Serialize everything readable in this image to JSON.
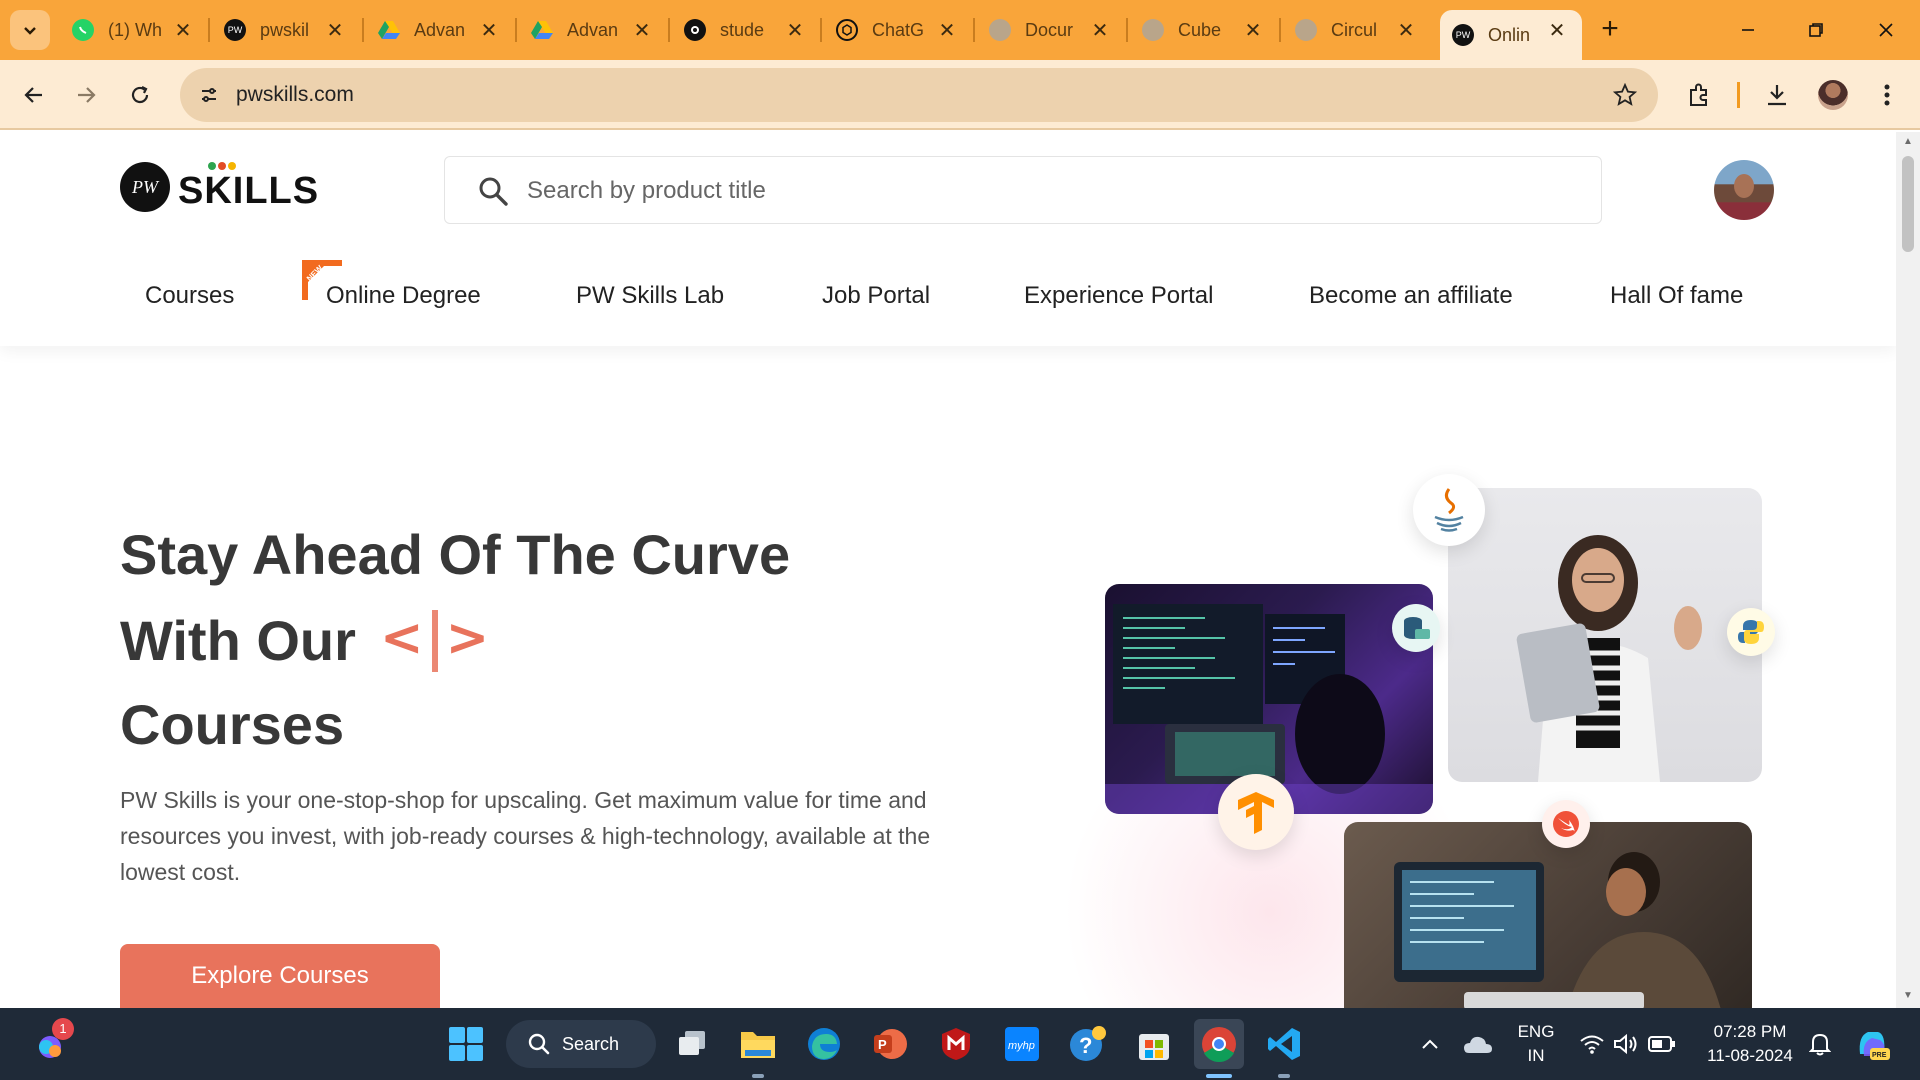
{
  "browser": {
    "tabs": [
      {
        "label": "(1) Wh",
        "icon": "whatsapp-icon"
      },
      {
        "label": "pwskil",
        "icon": "pwskills-favicon-icon"
      },
      {
        "label": "Advan",
        "icon": "google-drive-icon"
      },
      {
        "label": "Advan",
        "icon": "google-drive-icon"
      },
      {
        "label": "stude",
        "icon": "github-icon"
      },
      {
        "label": "ChatG",
        "icon": "chatgpt-icon"
      },
      {
        "label": "Docur",
        "icon": "globe-icon"
      },
      {
        "label": "Cube",
        "icon": "globe-icon"
      },
      {
        "label": "Circul",
        "icon": "globe-icon"
      },
      {
        "label": "Onlin",
        "icon": "pwskills-favicon-icon",
        "active": true
      }
    ],
    "new_tab": "+",
    "url": "pwskills.com"
  },
  "site": {
    "logo_badge": "PW",
    "logo_text": "SKILLS",
    "search_placeholder": "Search by product title",
    "nav": [
      "Courses",
      "Online Degree",
      "PW Skills Lab",
      "Job Portal",
      "Experience Portal",
      "Become an affiliate",
      "Hall Of fame"
    ],
    "new_badge": "NEW",
    "hero": {
      "line1": "Stay Ahead Of The Curve",
      "line2": "With Our",
      "code_symbol_left": "<",
      "code_symbol_right": ">",
      "line3": "Courses",
      "description": "PW Skills is your one-stop-shop for upscaling. Get maximum value for time and resources you invest, with job-ready courses & high-technology, available at the lowest cost.",
      "cta": "Explore Courses"
    },
    "tech_bubbles": [
      "java-icon",
      "sql-icon",
      "python-icon",
      "tensorflow-icon",
      "swift-icon"
    ]
  },
  "taskbar": {
    "search_label": "Search",
    "notification_count": "1",
    "language": "ENG",
    "region": "IN",
    "time": "07:28 PM",
    "date": "11-08-2024"
  },
  "colors": {
    "tabstrip": "#F9A53A",
    "toolbar": "#FDEBD3",
    "accent": "#E8735C",
    "taskbar": "#1f2a38"
  }
}
